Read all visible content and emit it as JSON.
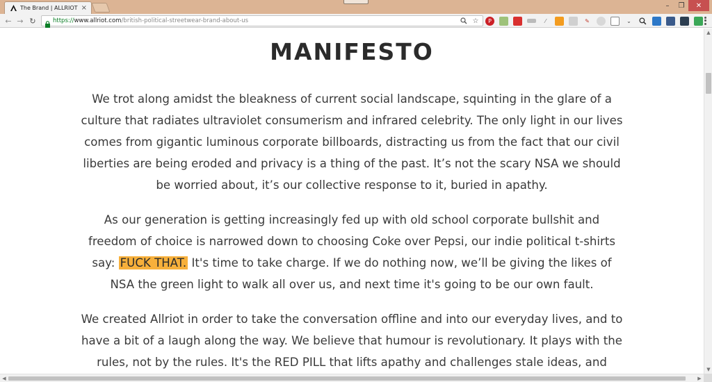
{
  "browser": {
    "tab": {
      "title": "The Brand | ALLRIOT Co",
      "close_glyph": "×"
    },
    "url": {
      "scheme": "https://",
      "host": "www.allriot.com",
      "path": "/british-political-streetwear-brand-about-us"
    },
    "window_controls": {
      "minimize": "–",
      "maximize": "❐",
      "close": "✕"
    },
    "nav": {
      "back": "←",
      "forward": "→",
      "reload": "↻"
    }
  },
  "page": {
    "title": "MANIFESTO",
    "paragraphs": [
      {
        "text": "We trot along amidst the bleakness of current social landscape, squinting in the glare of a culture that radiates ultraviolet consumerism and infrared celebrity. The only light in our lives comes from gigantic luminous corporate billboards, distracting us from the fact that our civil liberties are being eroded and privacy is a thing of the past. It’s not the scary NSA we should be worried about, it’s our collective response to it, buried in apathy."
      },
      {
        "before": "As our generation is getting increasingly fed up with old school corporate bullshit and freedom of choice is narrowed down to choosing Coke over Pepsi, our indie political t-shirts say: ",
        "highlight": "FUCK THAT.",
        "after": " It's time to take charge. If we do nothing now, we’ll be giving the likes of NSA the green light to walk all over us, and next time it's going to be our own fault."
      },
      {
        "text": "We created Allriot in order to take the conversation offline and into our everyday lives, and to have a bit of a laugh along the way. We believe that humour is revolutionary. It plays with the rules, not by the rules. It's the RED PILL that lifts apathy and challenges stale ideas, and"
      }
    ],
    "highlight_color": "#f7b03b"
  }
}
